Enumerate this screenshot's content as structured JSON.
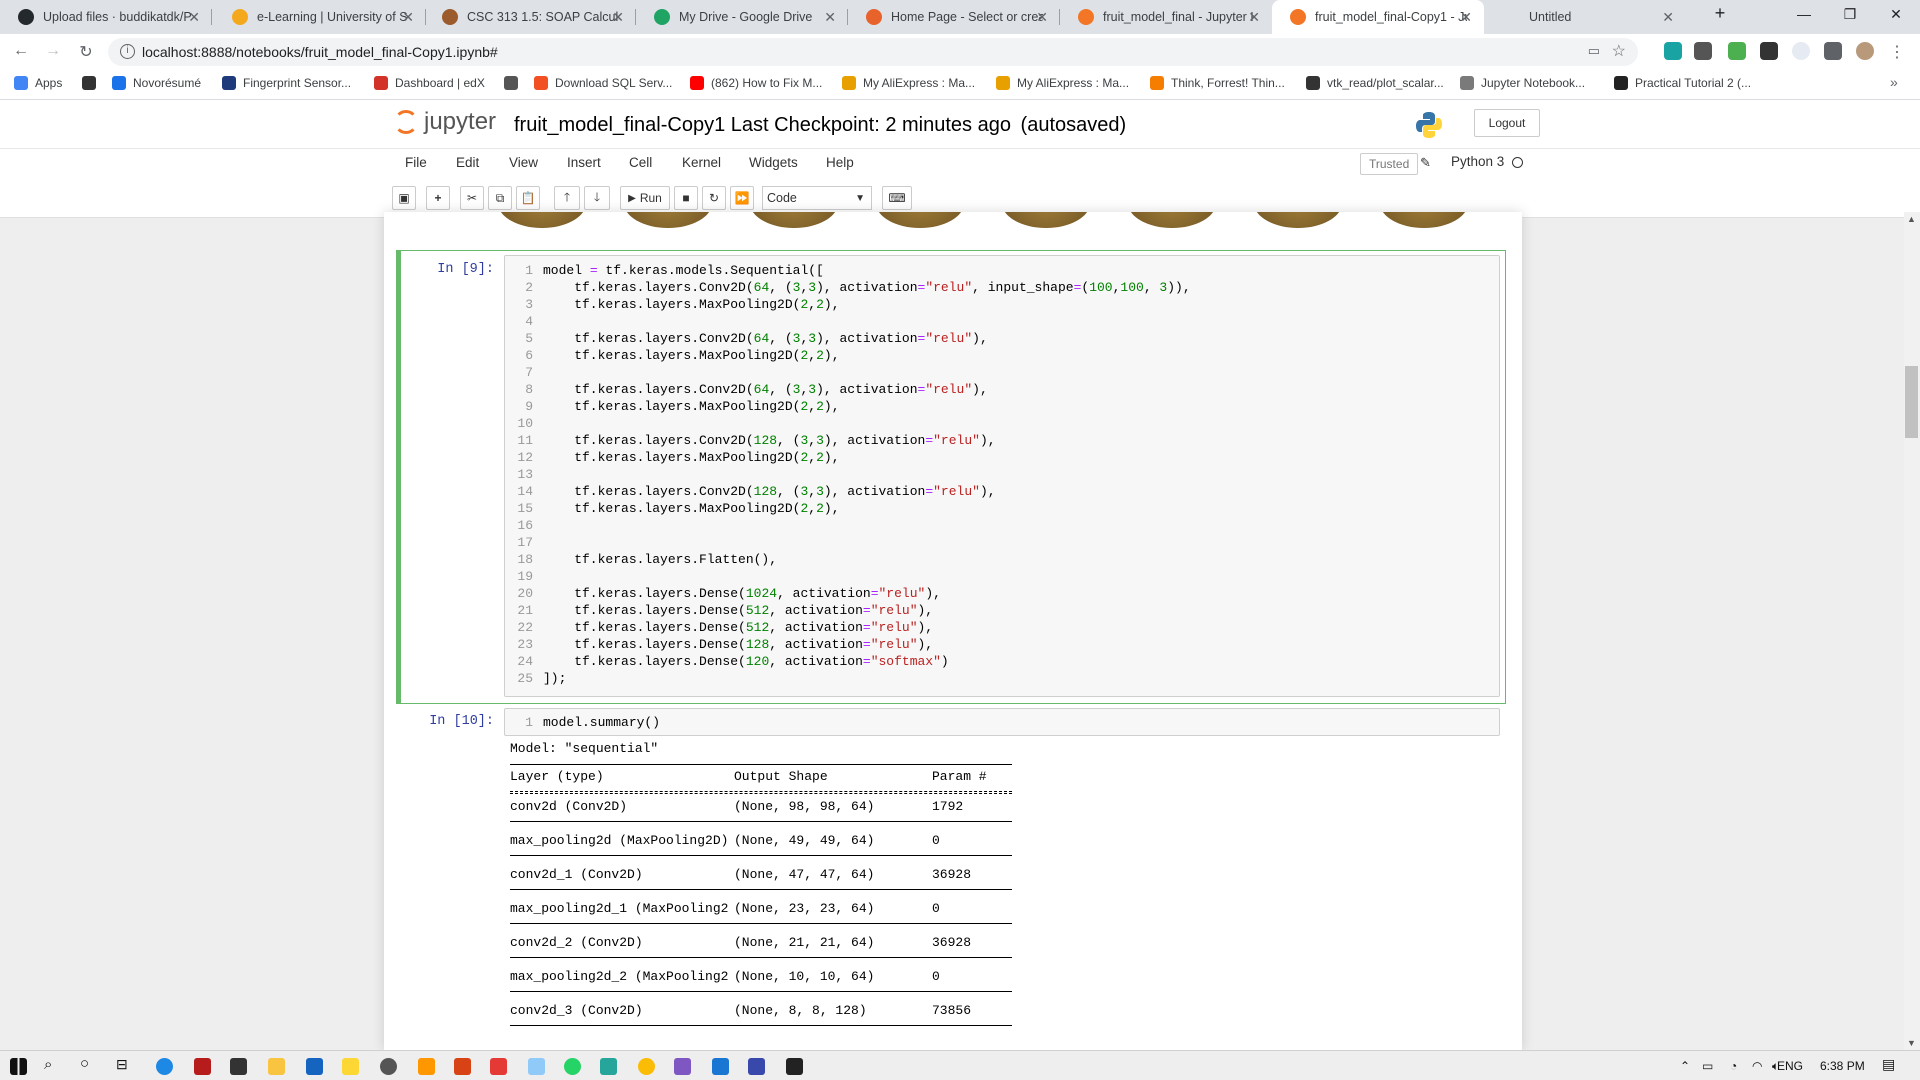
{
  "browser": {
    "tabs": [
      {
        "title": "Upload files · buddikatdk/P",
        "color": "#24292e"
      },
      {
        "title": "e-Learning | University of S",
        "color": "#f4a91c"
      },
      {
        "title": "CSC 313 1.5: SOAP Calculat",
        "color": "#9b5b2c"
      },
      {
        "title": "My Drive - Google Drive",
        "color": "#1fa463"
      },
      {
        "title": "Home Page - Select or crea",
        "color": "#e8622c"
      },
      {
        "title": "fruit_model_final - Jupyter I",
        "color": "#f37626"
      },
      {
        "title": "fruit_model_final-Copy1 - Ju",
        "color": "#f37626"
      },
      {
        "title": "Untitled",
        "color": "#dee1e6"
      }
    ],
    "url": "localhost:8888/notebooks/fruit_model_final-Copy1.ipynb#",
    "bookmarks": [
      {
        "label": "Apps",
        "color": "#4285f4"
      },
      {
        "label": "",
        "color": "#333333"
      },
      {
        "label": "Novorésumé",
        "color": "#1a73e8"
      },
      {
        "label": "Fingerprint Sensor...",
        "color": "#1f3a7a"
      },
      {
        "label": "Dashboard | edX",
        "color": "#d23228"
      },
      {
        "label": "",
        "color": "#555555"
      },
      {
        "label": "Download SQL Serv...",
        "color": "#f25022"
      },
      {
        "label": "(862) How to Fix M...",
        "color": "#ff0000"
      },
      {
        "label": "My AliExpress : Ma...",
        "color": "#e8a000"
      },
      {
        "label": "My AliExpress : Ma...",
        "color": "#e8a000"
      },
      {
        "label": "Think, Forrest! Thin...",
        "color": "#f57d00"
      },
      {
        "label": "vtk_read/plot_scalar...",
        "color": "#333333"
      },
      {
        "label": "Jupyter Notebook...",
        "color": "#7a7a7a"
      },
      {
        "label": "Practical Tutorial 2 (...",
        "color": "#222222"
      }
    ]
  },
  "jupyter": {
    "logo_text": "jupyter",
    "notebook_name": "fruit_model_final-Copy1",
    "checkpoint": "Last Checkpoint: 2 minutes ago",
    "autosave": "(autosaved)",
    "logout": "Logout",
    "menu": [
      "File",
      "Edit",
      "View",
      "Insert",
      "Cell",
      "Kernel",
      "Widgets",
      "Help"
    ],
    "trusted": "Trusted",
    "kernel_name": "Python 3",
    "run_label": "Run",
    "cell_type": "Code"
  },
  "cells": [
    {
      "prompt": "In [9]:",
      "lines": [
        "model = tf.keras.models.Sequential([",
        "    tf.keras.layers.Conv2D(64, (3,3), activation=\"relu\", input_shape=(100,100, 3)),",
        "    tf.keras.layers.MaxPooling2D(2,2),",
        "",
        "    tf.keras.layers.Conv2D(64, (3,3), activation=\"relu\"),",
        "    tf.keras.layers.MaxPooling2D(2,2),",
        "",
        "    tf.keras.layers.Conv2D(64, (3,3), activation=\"relu\"),",
        "    tf.keras.layers.MaxPooling2D(2,2),",
        "",
        "    tf.keras.layers.Conv2D(128, (3,3), activation=\"relu\"),",
        "    tf.keras.layers.MaxPooling2D(2,2),",
        "",
        "    tf.keras.layers.Conv2D(128, (3,3), activation=\"relu\"),",
        "    tf.keras.layers.MaxPooling2D(2,2),",
        "",
        "",
        "    tf.keras.layers.Flatten(),",
        "",
        "    tf.keras.layers.Dense(1024, activation=\"relu\"),",
        "    tf.keras.layers.Dense(512, activation=\"relu\"),",
        "    tf.keras.layers.Dense(512, activation=\"relu\"),",
        "    tf.keras.layers.Dense(128, activation=\"relu\"),",
        "    tf.keras.layers.Dense(120, activation=\"softmax\")",
        "]);"
      ]
    },
    {
      "prompt": "In [10]:",
      "lines": [
        "model.summary()"
      ]
    }
  ],
  "summary": {
    "model_line": "Model: \"sequential\"",
    "header": [
      "Layer (type)",
      "Output Shape",
      "Param #"
    ],
    "rows": [
      [
        "conv2d (Conv2D)",
        "(None, 98, 98, 64)",
        "1792"
      ],
      [
        "max_pooling2d (MaxPooling2D)",
        "(None, 49, 49, 64)",
        "0"
      ],
      [
        "conv2d_1 (Conv2D)",
        "(None, 47, 47, 64)",
        "36928"
      ],
      [
        "max_pooling2d_1 (MaxPooling2",
        "(None, 23, 23, 64)",
        "0"
      ],
      [
        "conv2d_2 (Conv2D)",
        "(None, 21, 21, 64)",
        "36928"
      ],
      [
        "max_pooling2d_2 (MaxPooling2",
        "(None, 10, 10, 64)",
        "0"
      ],
      [
        "conv2d_3 (Conv2D)",
        "(None, 8, 8, 128)",
        "73856"
      ]
    ]
  },
  "taskbar": {
    "language": "ENG",
    "time": "6:38 PM"
  }
}
